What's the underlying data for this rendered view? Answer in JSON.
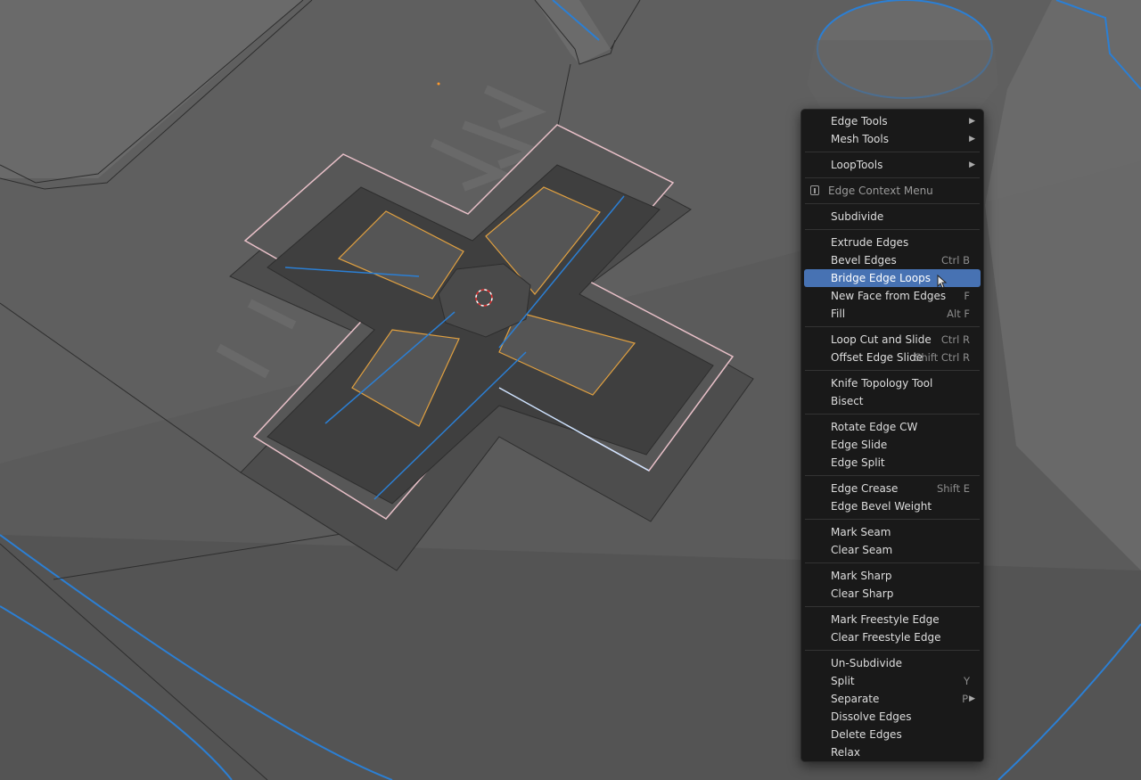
{
  "menu": {
    "header": {
      "label": "Edge Context Menu",
      "icon": "edge-menu-icon"
    },
    "items": [
      {
        "id": "edge-tools",
        "label": "Edge Tools",
        "submenu": true
      },
      {
        "id": "mesh-tools",
        "label": "Mesh Tools",
        "submenu": true
      },
      {
        "id": "sep"
      },
      {
        "id": "looptools",
        "label": "LoopTools",
        "submenu": true
      },
      {
        "id": "sep"
      },
      {
        "id": "header"
      },
      {
        "id": "sep"
      },
      {
        "id": "subdivide",
        "label": "Subdivide"
      },
      {
        "id": "sep"
      },
      {
        "id": "extrude-edges",
        "label": "Extrude Edges"
      },
      {
        "id": "bevel-edges",
        "label": "Bevel Edges",
        "shortcut": "Ctrl B"
      },
      {
        "id": "bridge-edge-loops",
        "label": "Bridge Edge Loops",
        "active": true
      },
      {
        "id": "new-face-from-edges",
        "label": "New Face from Edges",
        "shortcut": "F"
      },
      {
        "id": "fill",
        "label": "Fill",
        "shortcut": "Alt F"
      },
      {
        "id": "sep"
      },
      {
        "id": "loop-cut-and-slide",
        "label": "Loop Cut and Slide",
        "shortcut": "Ctrl R"
      },
      {
        "id": "offset-edge-slide",
        "label": "Offset Edge Slide",
        "shortcut": "Shift Ctrl R"
      },
      {
        "id": "sep"
      },
      {
        "id": "knife-topology-tool",
        "label": "Knife Topology Tool"
      },
      {
        "id": "bisect",
        "label": "Bisect"
      },
      {
        "id": "sep"
      },
      {
        "id": "rotate-edge-cw",
        "label": "Rotate Edge CW"
      },
      {
        "id": "edge-slide",
        "label": "Edge Slide"
      },
      {
        "id": "edge-split",
        "label": "Edge Split"
      },
      {
        "id": "sep"
      },
      {
        "id": "edge-crease",
        "label": "Edge Crease",
        "shortcut": "Shift E"
      },
      {
        "id": "edge-bevel-weight",
        "label": "Edge Bevel Weight"
      },
      {
        "id": "sep"
      },
      {
        "id": "mark-seam",
        "label": "Mark Seam"
      },
      {
        "id": "clear-seam",
        "label": "Clear Seam"
      },
      {
        "id": "sep"
      },
      {
        "id": "mark-sharp",
        "label": "Mark Sharp"
      },
      {
        "id": "clear-sharp",
        "label": "Clear Sharp"
      },
      {
        "id": "sep"
      },
      {
        "id": "mark-freestyle-edge",
        "label": "Mark Freestyle Edge"
      },
      {
        "id": "clear-freestyle-edge",
        "label": "Clear Freestyle Edge"
      },
      {
        "id": "sep"
      },
      {
        "id": "un-subdivide",
        "label": "Un-Subdivide"
      },
      {
        "id": "split",
        "label": "Split",
        "shortcut": "Y"
      },
      {
        "id": "separate",
        "label": "Separate",
        "shortcut": "P",
        "submenu": true
      },
      {
        "id": "dissolve-edges",
        "label": "Dissolve Edges"
      },
      {
        "id": "delete-edges",
        "label": "Delete Edges"
      },
      {
        "id": "relax",
        "label": "Relax"
      }
    ]
  },
  "colors": {
    "menu_bg": "#191919",
    "highlight": "#4772b3",
    "viewport_bg": "#5a5a5a",
    "selected_edge": "#2b7fd4",
    "selected_face_outline": "#e0a040",
    "active_outline": "#e8c0c8"
  },
  "icons": [
    "edge-menu-icon",
    "submenu-arrow-icon",
    "mouse-cursor-icon",
    "3d-cursor-icon",
    "origin-dot-icon"
  ]
}
